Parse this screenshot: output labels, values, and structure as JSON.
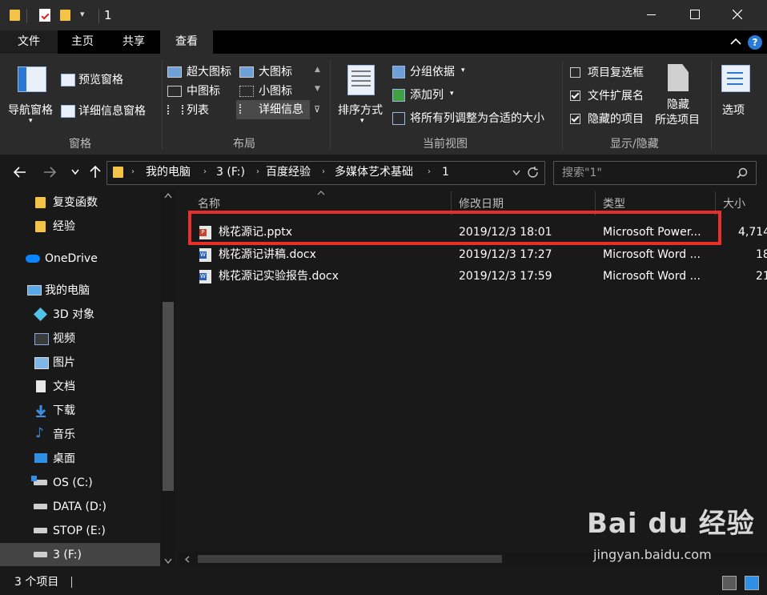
{
  "window": {
    "title": "1",
    "qat_pin": "▾"
  },
  "tabs": [
    {
      "label": "文件"
    },
    {
      "label": "主页"
    },
    {
      "label": "共享"
    },
    {
      "label": "查看"
    }
  ],
  "ribbon": {
    "groups": {
      "panes": "窗格",
      "layout": "布局",
      "current_view": "当前视图",
      "show_hide": "显示/隐藏"
    },
    "nav_pane": "导航窗格",
    "preview_pane": "预览窗格",
    "details_pane": "详细信息窗格",
    "layouts": {
      "xl_icons": "超大图标",
      "large_icons": "大图标",
      "medium_icons": "中图标",
      "small_icons": "小图标",
      "list": "列表",
      "details": "详细信息"
    },
    "sort_by": "排序方式",
    "group_by": "分组依据",
    "add_columns": "添加列",
    "size_all_columns": "将所有列调整为合适的大小",
    "item_checkboxes": "项目复选框",
    "file_extensions": "文件扩展名",
    "hidden_items": "隐藏的项目",
    "hide_selected_1": "隐藏",
    "hide_selected_2": "所选项目",
    "options": "选项"
  },
  "address": {
    "path": [
      "我的电脑",
      "3 (F:)",
      "百度经验",
      "多媒体艺术基础",
      "1"
    ],
    "search_placeholder": "搜索\"1\""
  },
  "sidebar": {
    "items": [
      {
        "label": "复变函数"
      },
      {
        "label": "经验"
      },
      {
        "label": "OneDrive"
      },
      {
        "label": "我的电脑"
      },
      {
        "label": "3D 对象"
      },
      {
        "label": "视频"
      },
      {
        "label": "图片"
      },
      {
        "label": "文档"
      },
      {
        "label": "下载"
      },
      {
        "label": "音乐"
      },
      {
        "label": "桌面"
      },
      {
        "label": "OS (C:)"
      },
      {
        "label": "DATA (D:)"
      },
      {
        "label": "STOP (E:)"
      },
      {
        "label": "3 (F:)"
      }
    ]
  },
  "columns": {
    "name": "名称",
    "modified": "修改日期",
    "type": "类型",
    "size": "大小"
  },
  "files": [
    {
      "name": "桃花源记.pptx",
      "date": "2019/12/3 18:01",
      "type": "Microsoft Power...",
      "size": "4,714"
    },
    {
      "name": "桃花源记讲稿.docx",
      "date": "2019/12/3 17:27",
      "type": "Microsoft Word ...",
      "size": "18"
    },
    {
      "name": "桃花源记实验报告.docx",
      "date": "2019/12/3 17:59",
      "type": "Microsoft Word ...",
      "size": "21"
    }
  ],
  "status": {
    "count": "3 个项目"
  },
  "watermark": {
    "brand": "Bai du 经验",
    "url": "jingyan.baidu.com"
  },
  "colors": {
    "accent_highlight": "#e8302a",
    "onedrive": "#0a84ff",
    "folder": "#f3c348"
  }
}
